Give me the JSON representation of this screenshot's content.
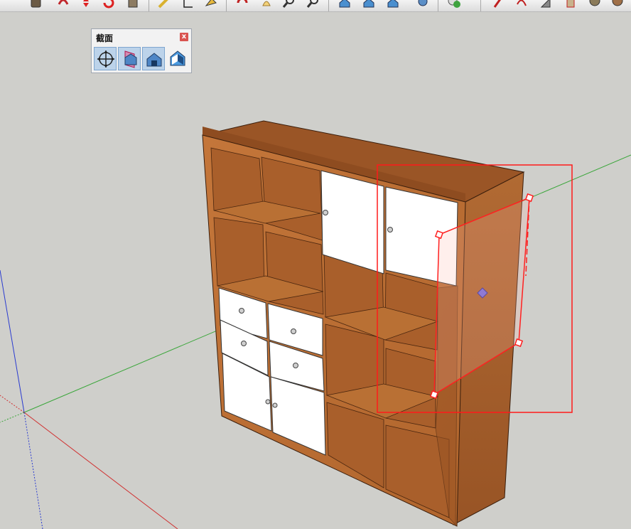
{
  "panel": {
    "title": "截面",
    "close_label": "x",
    "tools": [
      {
        "icon": "section-plane-icon",
        "active": true
      },
      {
        "icon": "display-section-planes-icon",
        "active": true
      },
      {
        "icon": "display-section-cuts-icon",
        "active": true
      },
      {
        "icon": "section-fill-icon",
        "active": false
      }
    ]
  },
  "toolbar": {
    "icons": [
      "paint-bucket-icon",
      "orbit-icon",
      "move-icon",
      "rotate-icon",
      "push-pull-icon",
      "tape-measure-icon",
      "dimension-icon",
      "paint-icon",
      "undo-icon",
      "pan-icon",
      "zoom-icon",
      "zoom-extents-icon",
      "warehouse-icon",
      "warehouse-share-icon",
      "extension-warehouse-icon",
      "extension-manager-icon",
      "model-info-icon",
      "pencil-icon",
      "freehand-icon",
      "eraser-icon",
      "scale-icon",
      "follow-me-icon",
      "offset-icon"
    ]
  },
  "colors": {
    "wood": "#b8692f",
    "wood_dark": "#8d4d21",
    "door_white": "#ffffff",
    "section_red": "#ff1a1a",
    "background": "#cfcfcb"
  }
}
